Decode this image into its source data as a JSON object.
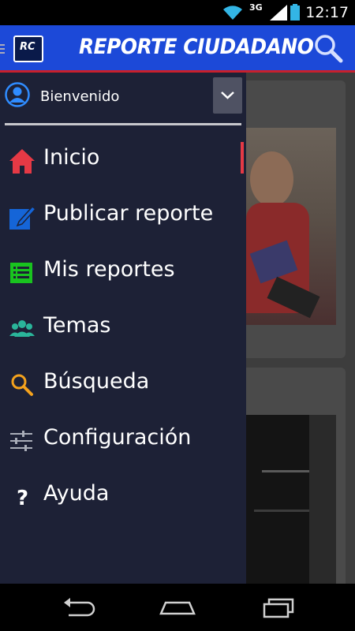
{
  "status_bar": {
    "time": "12:17",
    "network": "3G"
  },
  "app_bar": {
    "title": "REPORTE CIUDADANO",
    "logo_text": "RC"
  },
  "drawer": {
    "welcome": "Bienvenido",
    "items": [
      {
        "label": "Inicio",
        "icon": "home-icon",
        "active": true
      },
      {
        "label": "Publicar reporte",
        "icon": "edit-icon",
        "active": false
      },
      {
        "label": "Mis reportes",
        "icon": "list-icon",
        "active": false
      },
      {
        "label": "Temas",
        "icon": "group-icon",
        "active": false
      },
      {
        "label": "Búsqueda",
        "icon": "search-icon",
        "active": false
      },
      {
        "label": "Configuración",
        "icon": "settings-sliders-icon",
        "active": false
      },
      {
        "label": "Ayuda",
        "icon": "help-icon",
        "active": false
      }
    ]
  },
  "colors": {
    "app_bar": "#1c49d8",
    "drawer": "#1d2136",
    "accent_red": "#e53945"
  }
}
